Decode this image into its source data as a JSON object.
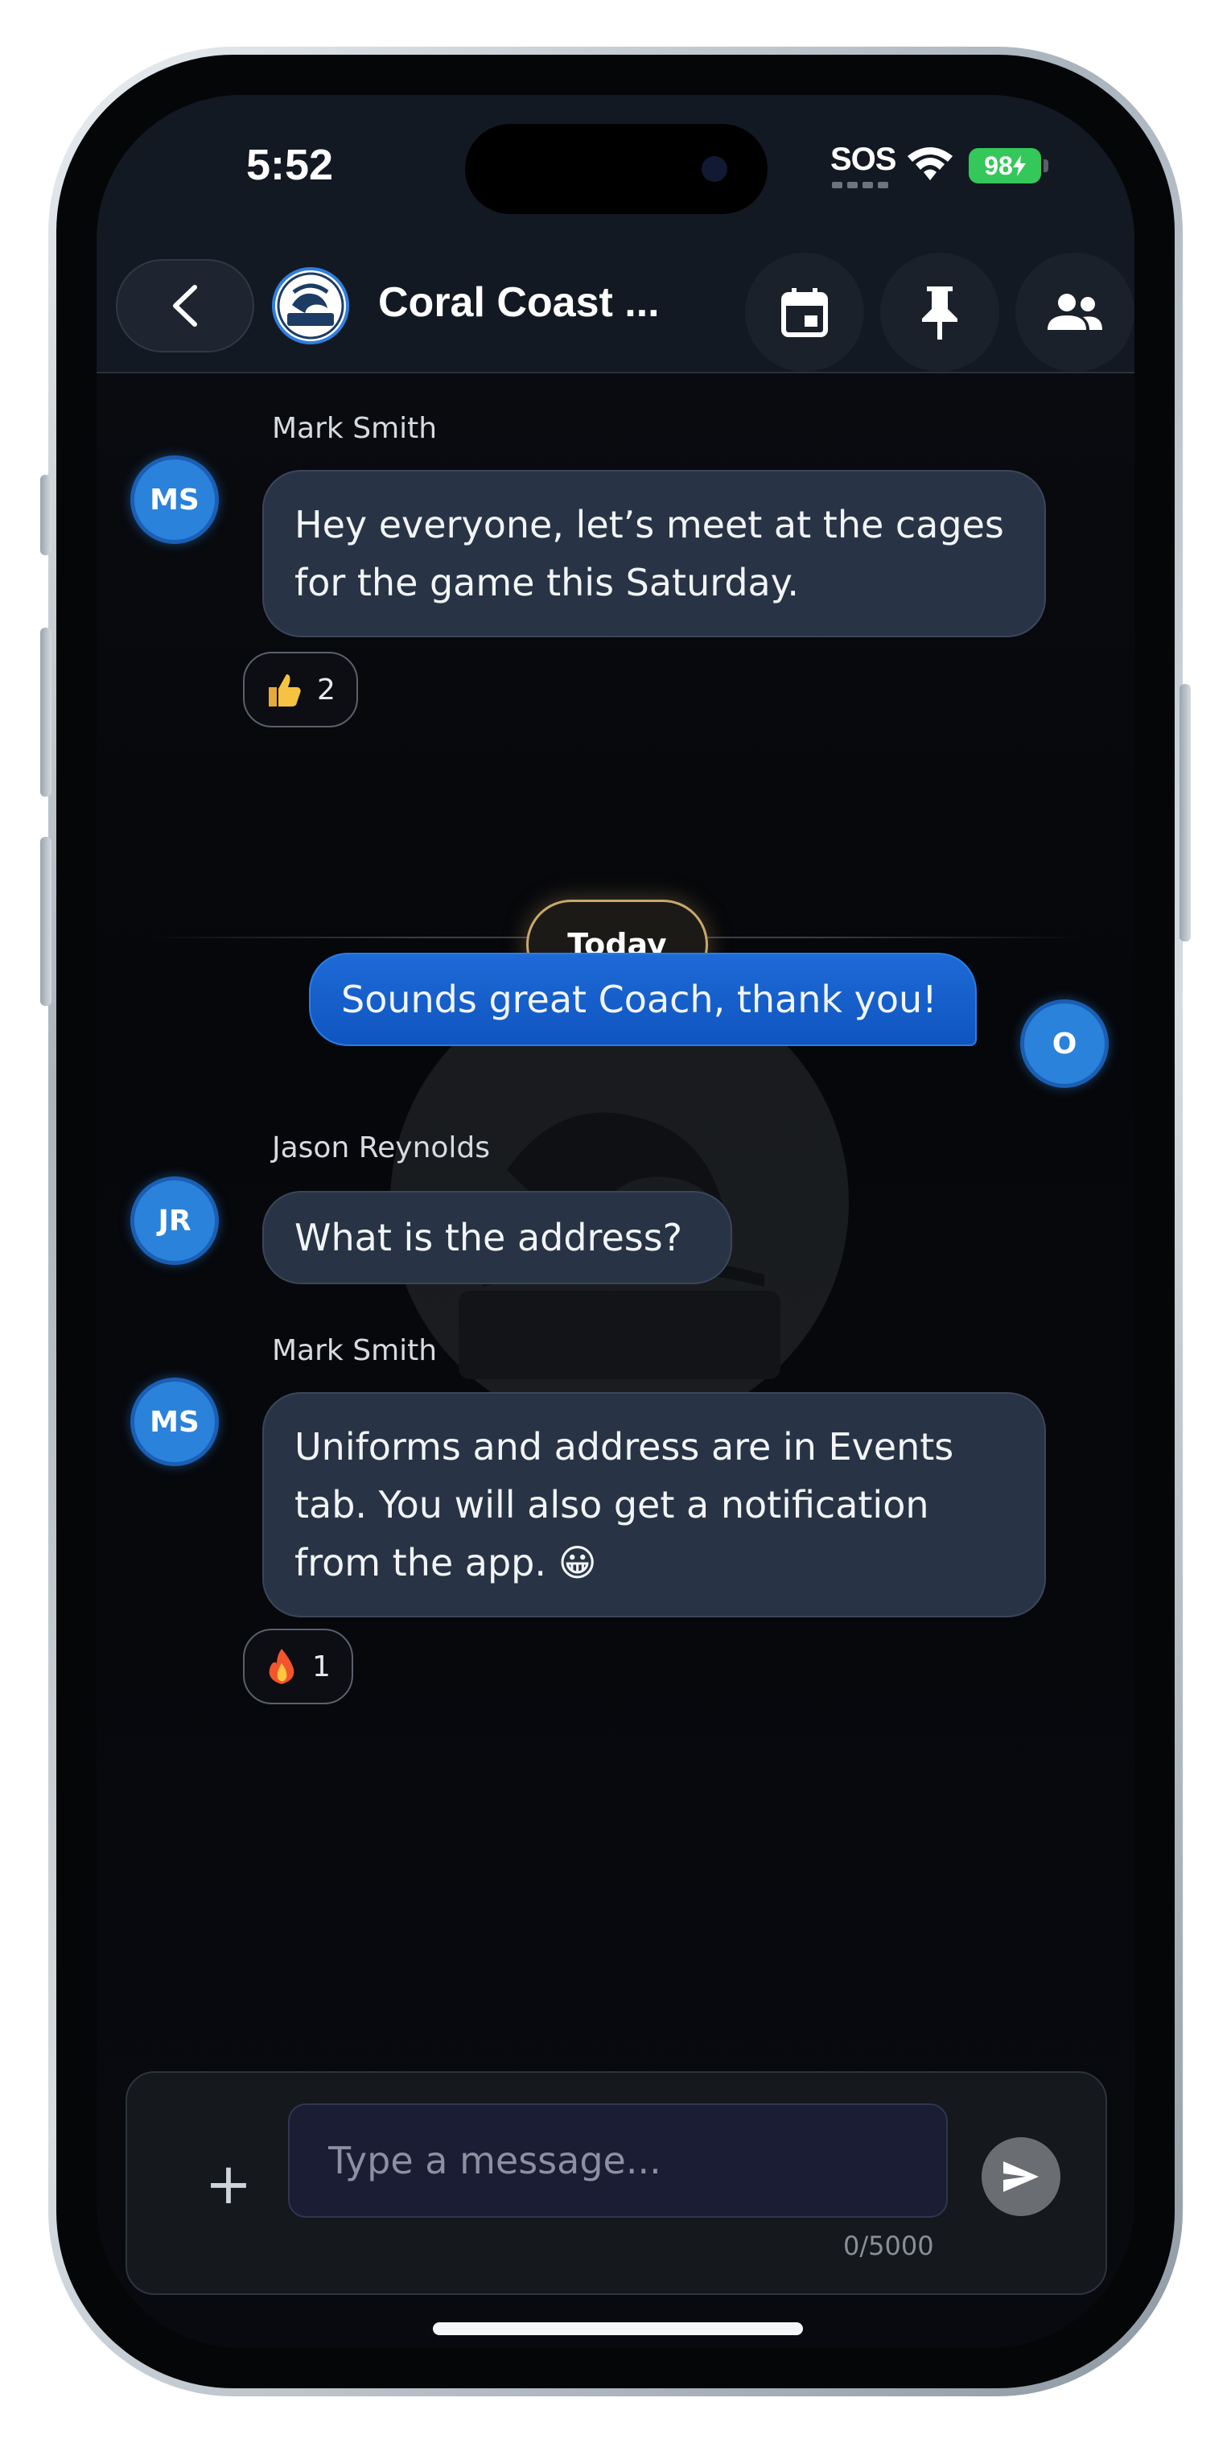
{
  "status_bar": {
    "time": "5:52",
    "sos": "SOS",
    "battery": "98"
  },
  "header": {
    "title": "Coral Coast ...",
    "logo_icon": "coral-coast-crushers-logo"
  },
  "messages": [
    {
      "sender": "Mark Smith",
      "initials": "MS",
      "text": "Hey everyone, let’s meet at the cages for the game this Saturday.",
      "reaction_count": "2"
    },
    {
      "text": "Sounds great Coach, thank you!",
      "initials": "O"
    },
    {
      "sender": "Jason Reynolds",
      "initials": "JR",
      "text": "What is the address?"
    },
    {
      "sender": "Mark Smith",
      "initials": "MS",
      "text": "Uniforms and address are in Events tab. You will also get a notification from the app. 😀",
      "reaction_count": "1"
    }
  ],
  "divider_label": "Today",
  "composer": {
    "placeholder": "Type a message...",
    "char_count": "0/5000"
  },
  "colors": {
    "accent": "#2a82db",
    "bubble": "#283445",
    "my_bubble": "#1e6ad6",
    "today_border": "#c9a86a"
  }
}
